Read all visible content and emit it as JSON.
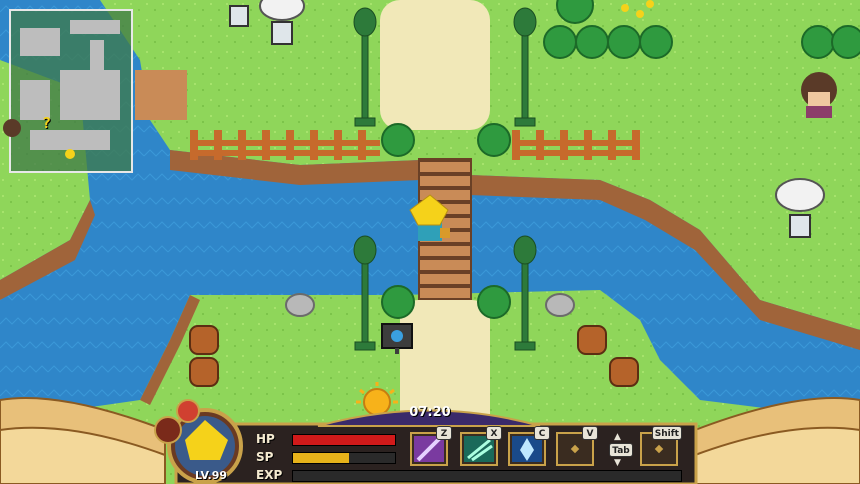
{
  "hud": {
    "time": "07:20",
    "level": "LV.99",
    "hp_label": "HP",
    "sp_label": "SP",
    "exp_label": "EXP",
    "hp_fraction": 1.0,
    "sp_fraction": 0.55,
    "exp_fraction": 0.0,
    "colors": {
      "hp": "#d11a1a",
      "sp": "#e7b21a",
      "exp": "#6bbf4a",
      "frame": "#c9a24a"
    }
  },
  "skills": [
    {
      "key": "Z",
      "icon": "sword-slash-icon"
    },
    {
      "key": "X",
      "icon": "wind-blade-icon"
    },
    {
      "key": "C",
      "icon": "ice-crystal-icon"
    },
    {
      "key": "V",
      "icon": "empty-slot-icon"
    },
    {
      "key": "Shift",
      "icon": "empty-slot-icon"
    }
  ],
  "tab_key": "Tab",
  "minimap": {
    "marker": "?"
  }
}
